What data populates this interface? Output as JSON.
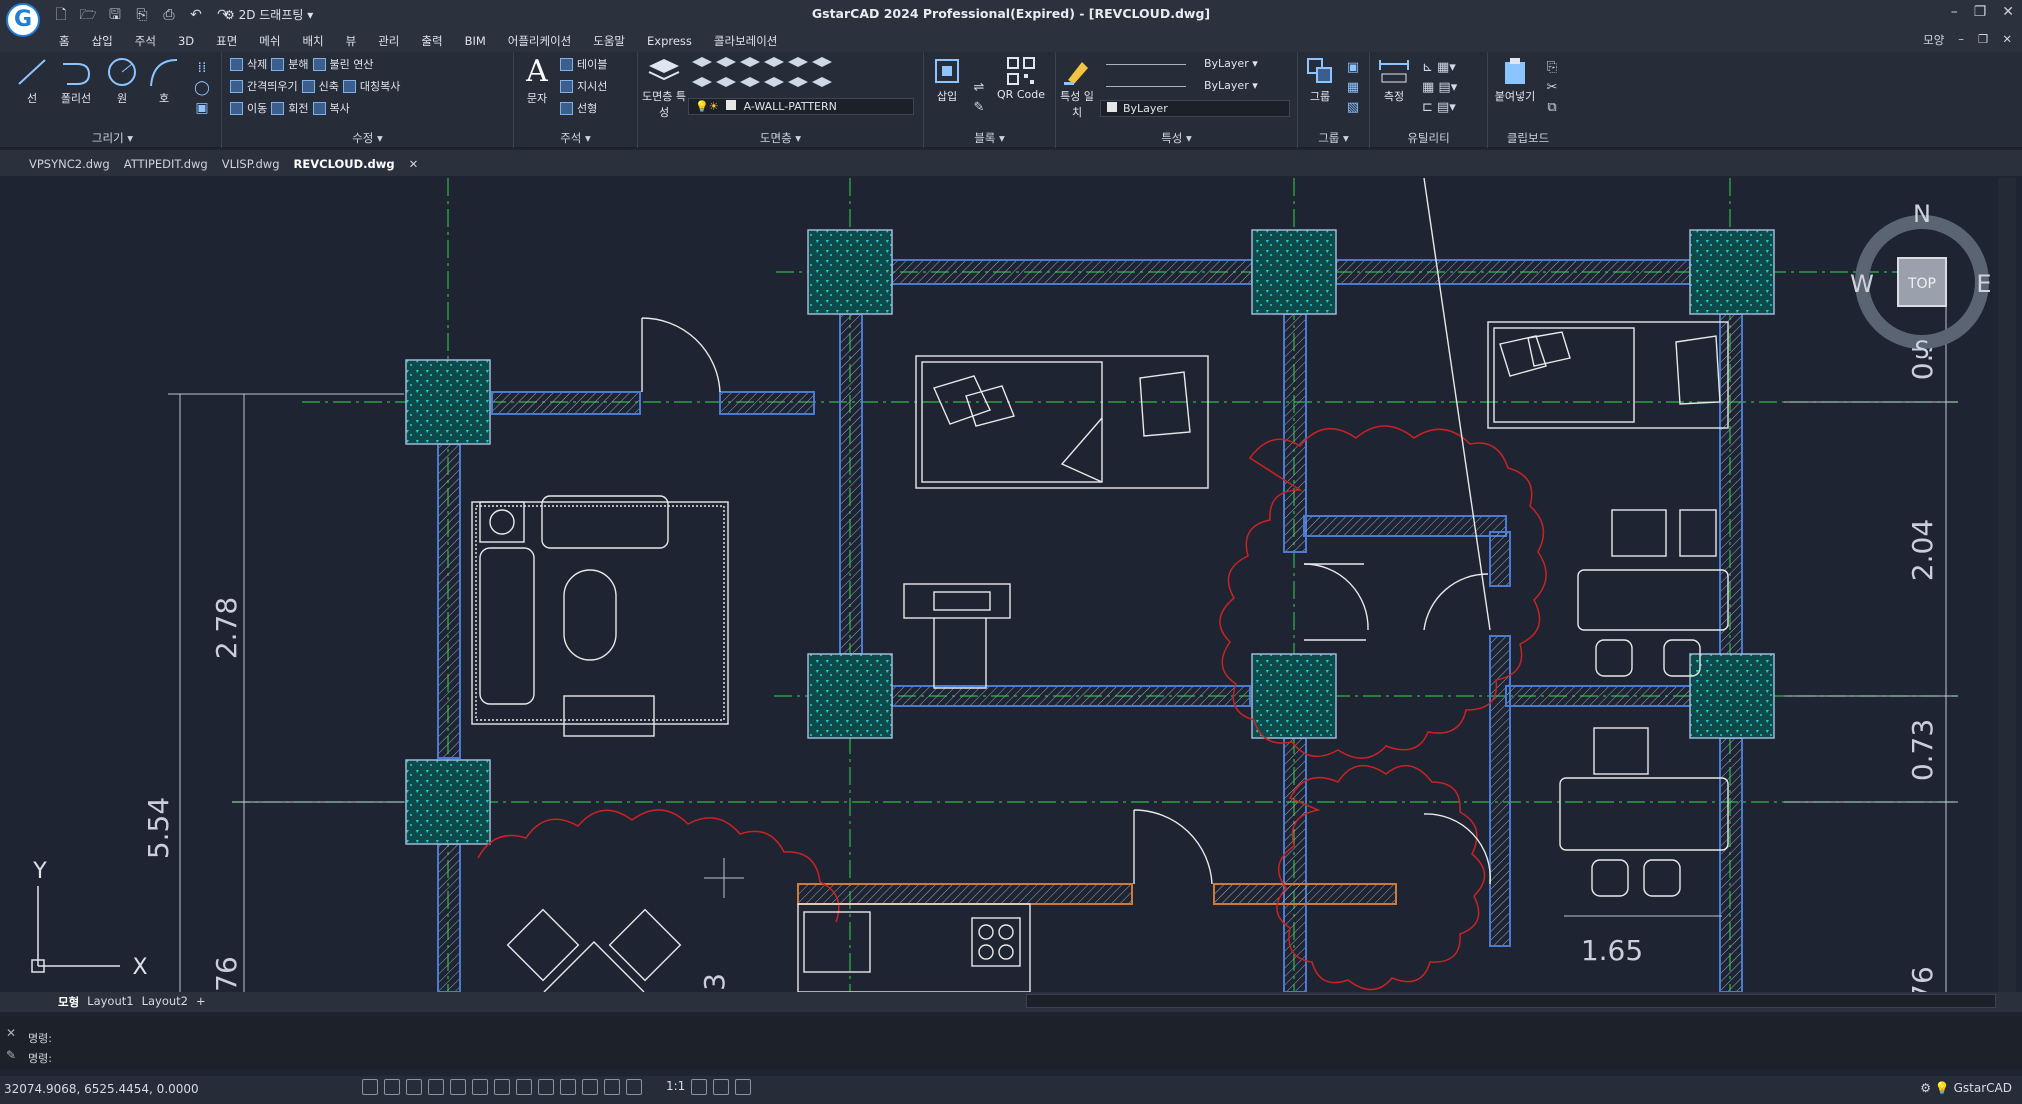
{
  "app": {
    "logo": "G",
    "window_title": "GstarCAD 2024 Professional(Expired) - [REVCLOUD.dwg]",
    "workspace": "2D 드래프팅",
    "window_controls": [
      "–",
      "❐",
      "✕"
    ]
  },
  "menu": {
    "tabs": [
      "홈",
      "삽입",
      "주석",
      "3D",
      "표면",
      "메쉬",
      "배치",
      "뷰",
      "관리",
      "출력",
      "BIM",
      "어플리케이션",
      "도움말",
      "Express",
      "콜라보레이션"
    ],
    "right": [
      "모양",
      "–",
      "❐",
      "✕"
    ]
  },
  "ribbon": {
    "draw": {
      "title": "그리기",
      "tools": [
        "선",
        "폴리선",
        "원",
        "호"
      ]
    },
    "modify": {
      "title": "수정",
      "rows": [
        [
          "삭제",
          "분해",
          "불린 연산"
        ],
        [
          "간격띄우기",
          "신축",
          "대칭복사"
        ],
        [
          "이동",
          "회전",
          "복사"
        ]
      ]
    },
    "annotation": {
      "title": "주석",
      "text_tool": "문자",
      "table": "테이블",
      "leader": "지시선",
      "linear": "선형"
    },
    "layers": {
      "title": "도면층",
      "props_tool": "도면층 특성",
      "current_layer": "A-WALL-PATTERN"
    },
    "block": {
      "title": "블록",
      "insert": "삽입",
      "qr": "QR Code"
    },
    "properties": {
      "title": "특성",
      "match": "특성 일치",
      "bylayer": [
        "ByLayer",
        "ByLayer",
        "ByLayer"
      ]
    },
    "group": {
      "title": "그룹",
      "tool": "그룹"
    },
    "utilities": {
      "title": "유틸리티",
      "measure": "측정"
    },
    "clipboard": {
      "title": "클립보드",
      "paste": "붙여넣기"
    }
  },
  "file_tabs": [
    "VPSYNC2.dwg",
    "ATTIPEDIT.dwg",
    "VLISP.dwg",
    "REVCLOUD.dwg"
  ],
  "drawing": {
    "dimensions": [
      "2.78",
      "5.54",
      "2.04",
      "0.73",
      "1.65",
      "0.5",
      "76",
      "3",
      "76"
    ],
    "viewcube": {
      "top": "TOP",
      "n": "N",
      "s": "S",
      "e": "E",
      "w": "W"
    },
    "ucs": {
      "x": "X",
      "y": "Y"
    }
  },
  "layout_tabs": [
    "모형",
    "Layout1",
    "Layout2",
    "+"
  ],
  "command": {
    "lines": [
      "명령:",
      "명령:"
    ]
  },
  "status": {
    "coords": "32074.9068, 6525.4454, 0.0000",
    "scale": "1:1",
    "right_label": "GstarCAD"
  },
  "colors": {
    "background": "#1e2432",
    "wall": "#4a7bd0",
    "axis": "#35c34a",
    "cloud": "#d22828",
    "column": "#1fc1c1"
  }
}
